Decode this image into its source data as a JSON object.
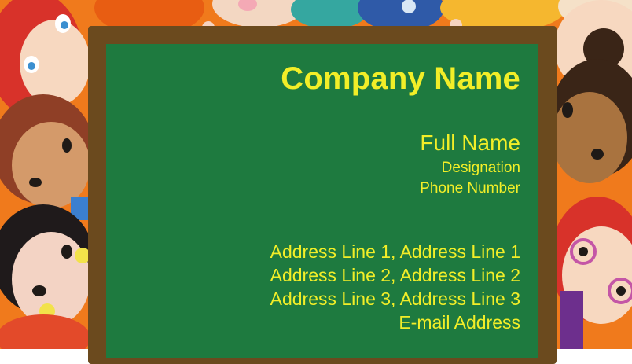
{
  "card": {
    "company_name": "Company Name",
    "full_name": "Full Name",
    "designation": "Designation",
    "phone": "Phone Number",
    "address_line_1": "Address Line 1,  Address Line 1",
    "address_line_2": "Address Line 2,  Address Line 2",
    "address_line_3": "Address Line 3,  Address Line 3",
    "email": "E-mail Address"
  },
  "colors": {
    "background": "#f07a1c",
    "board": "#1e7a3f",
    "frame": "#6b4a1e",
    "text": "#f2ee28"
  }
}
